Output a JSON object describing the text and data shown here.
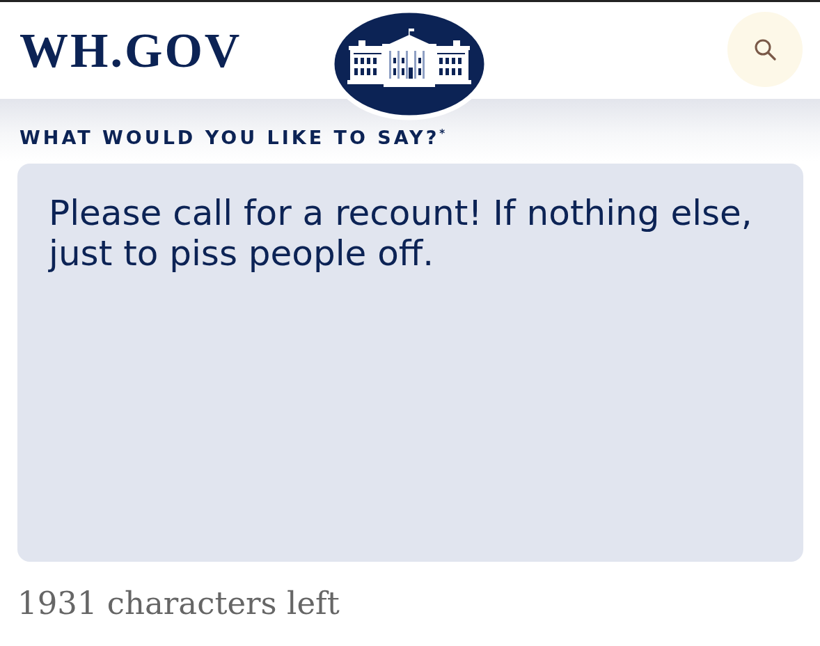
{
  "header": {
    "logo": "WH.GOV"
  },
  "form": {
    "label": "WHAT WOULD YOU LIKE TO SAY?$^{*}$",
    "value": "Please call for a recount! If nothing else, just to piss people off.",
    "counter": "1931 characters left"
  }
}
